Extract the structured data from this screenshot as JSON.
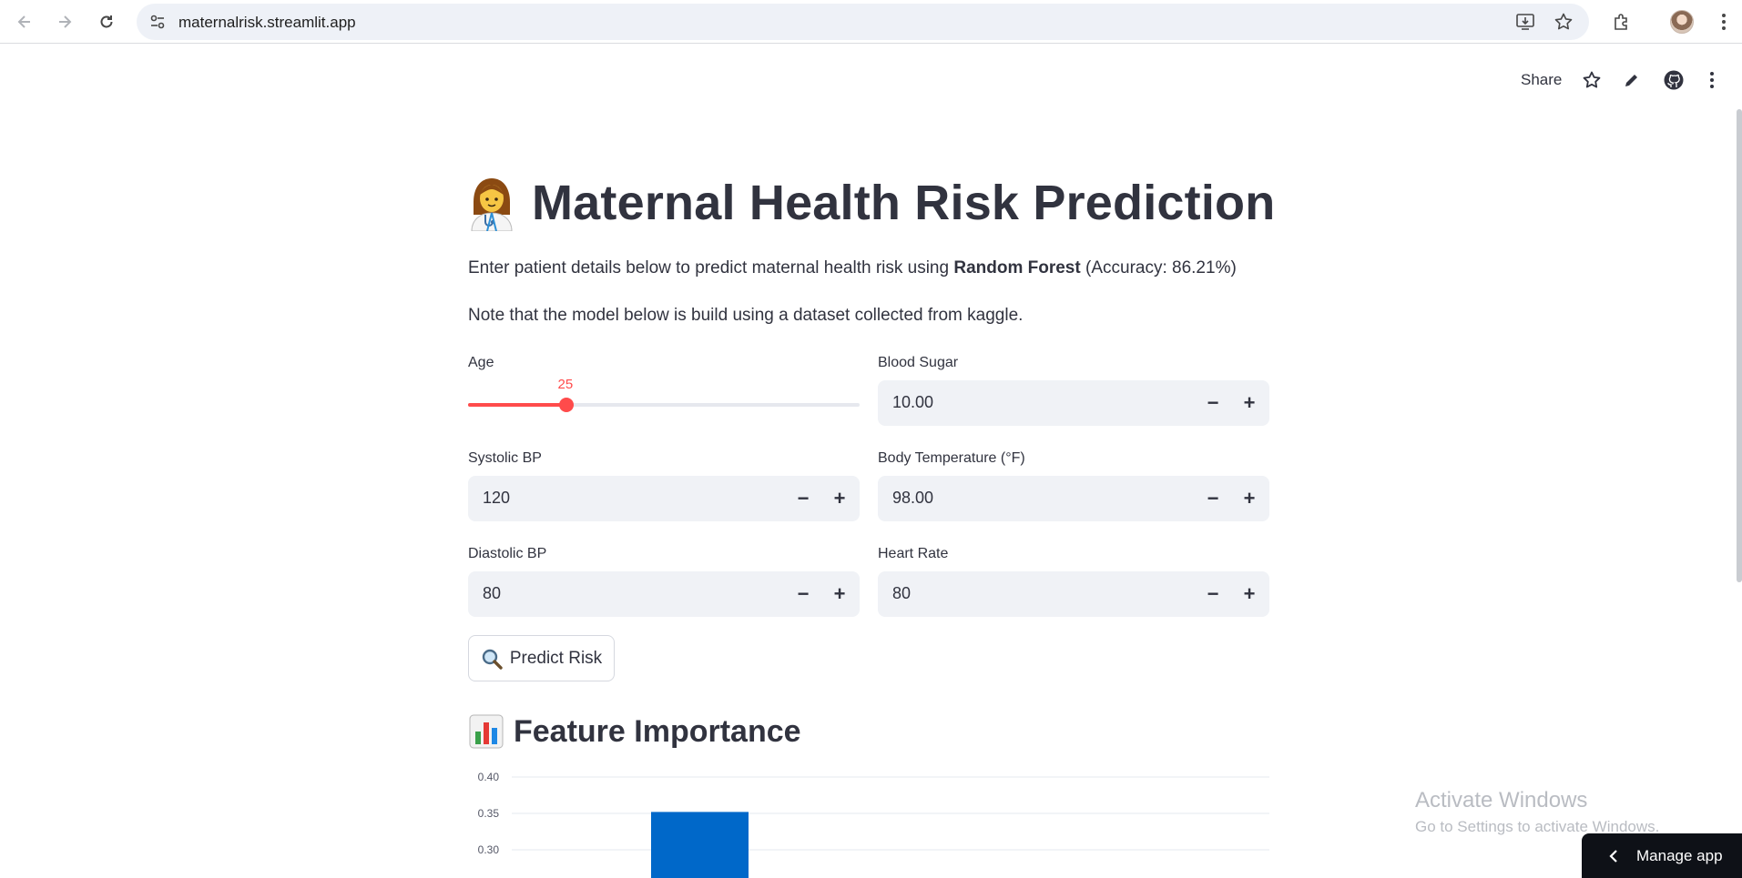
{
  "browser": {
    "url": "maternalrisk.streamlit.app"
  },
  "toolbar": {
    "share_label": "Share"
  },
  "page": {
    "title": "Maternal Health Risk Prediction",
    "desc_prefix": "Enter patient details below to predict maternal health risk using ",
    "desc_bold": "Random Forest",
    "desc_suffix": " (Accuracy: 86.21%)",
    "note": "Note that the model below is build using a dataset collected from kaggle."
  },
  "form": {
    "age": {
      "label": "Age",
      "value": "25",
      "min": 10,
      "max": 70,
      "current": 25
    },
    "blood_sugar": {
      "label": "Blood Sugar",
      "value": "10.00"
    },
    "systolic_bp": {
      "label": "Systolic BP",
      "value": "120"
    },
    "body_temp": {
      "label": "Body Temperature (°F)",
      "value": "98.00"
    },
    "diastolic_bp": {
      "label": "Diastolic BP",
      "value": "80"
    },
    "heart_rate": {
      "label": "Heart Rate",
      "value": "80"
    },
    "predict_label": "Predict Risk"
  },
  "feature_section": {
    "title": "Feature Importance"
  },
  "chart_data": {
    "type": "bar",
    "ytick_labels": [
      "0.40",
      "0.35",
      "0.30"
    ],
    "ylim": [
      0.25,
      0.4
    ],
    "values": [
      0.352
    ],
    "color": "#0068c9"
  },
  "watermark": {
    "line1": "Activate Windows",
    "line2": "Go to Settings to activate Windows."
  },
  "manage_app": {
    "label": "Manage app"
  }
}
